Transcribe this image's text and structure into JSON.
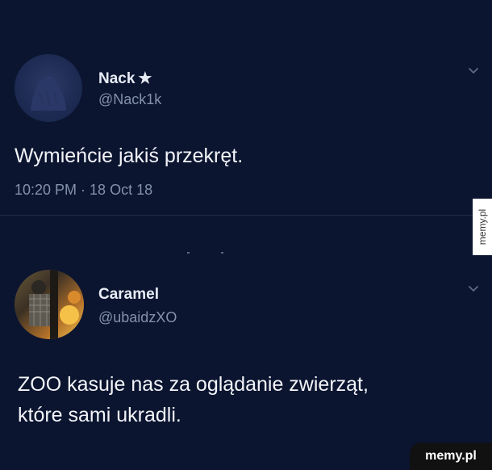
{
  "tweets": [
    {
      "name": "Nack",
      "verified_mark": "★",
      "handle": "@Nack1k",
      "text": "Wymieńcie jakiś przekręt.",
      "timestamp": "10:20 PM · 18 Oct 18",
      "icons": [
        "avatar",
        "star-icon",
        "chevron-down-icon"
      ]
    },
    {
      "name": "Caramel",
      "handle": "@ubaidzXO",
      "text_lines": [
        "ZOO kasuje nas za oglądanie zwierząt,",
        "które sami ukradli."
      ],
      "icons": [
        "avatar",
        "chevron-down-icon"
      ]
    }
  ],
  "watermarks": {
    "side": "memy.pl",
    "corner": "memy.pl"
  },
  "colors": {
    "background": "#0b1530",
    "text": "#f2f4f8",
    "muted": "#8591a8"
  }
}
